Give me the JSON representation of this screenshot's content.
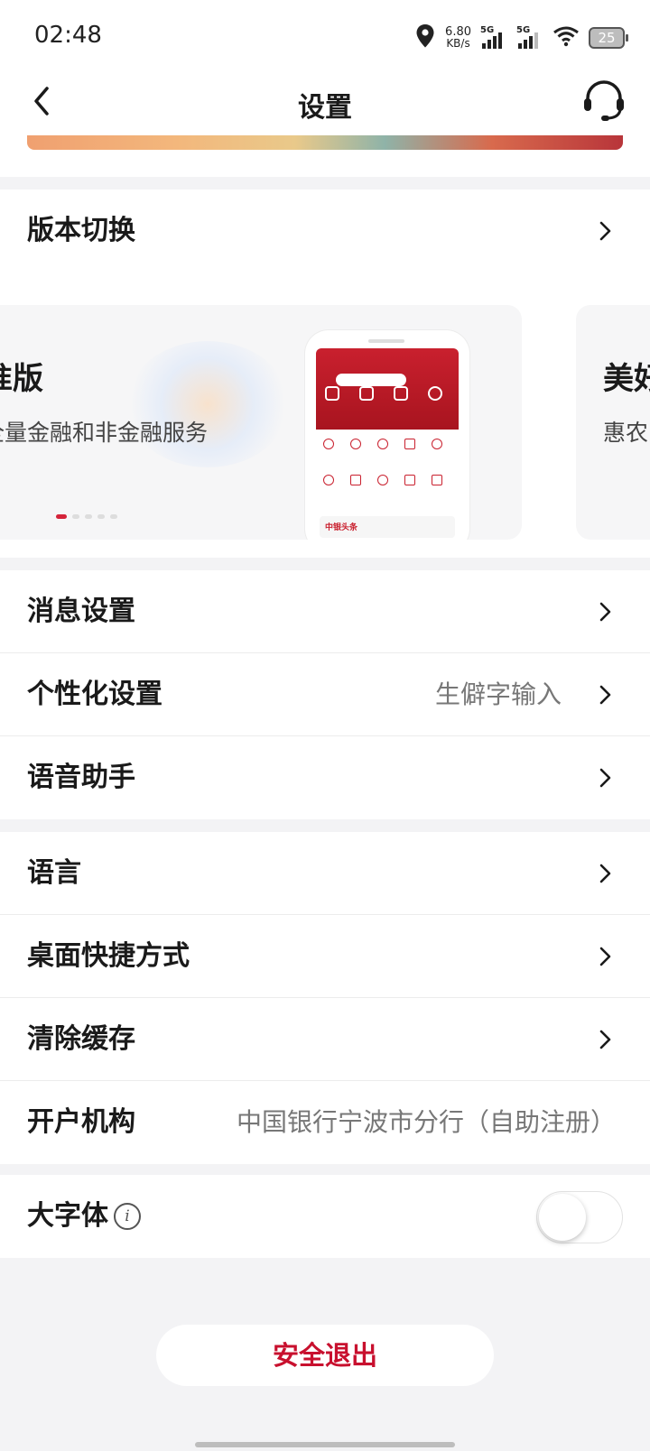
{
  "status_bar": {
    "time": "02:48",
    "net_speed_value": "6.80",
    "net_speed_unit": "KB/s",
    "sim1_label": "5G",
    "sim2_label": "5G",
    "battery": "25"
  },
  "header": {
    "title": "设置"
  },
  "version_section": {
    "label": "版本切换"
  },
  "version_carousel": {
    "cards": [
      {
        "title": "准版",
        "subtitle": "全量金融和非金融服务"
      },
      {
        "title": "美好",
        "subtitle": "惠农"
      }
    ],
    "dots": 5,
    "active_dot": 0,
    "preview": {
      "news_label": "中银头条"
    }
  },
  "settings_group_1": [
    {
      "label": "消息设置",
      "value": ""
    },
    {
      "label": "个性化设置",
      "value": "生僻字输入"
    },
    {
      "label": "语音助手",
      "value": ""
    }
  ],
  "settings_group_2": [
    {
      "label": "语言",
      "value": ""
    },
    {
      "label": "桌面快捷方式",
      "value": ""
    },
    {
      "label": "清除缓存",
      "value": ""
    },
    {
      "label": "开户机构",
      "value": "中国银行宁波市分行（自助注册）"
    }
  ],
  "large_font": {
    "label": "大字体",
    "info_glyph": "i",
    "enabled": false
  },
  "logout": {
    "label": "安全退出"
  },
  "colors": {
    "accent": "#c8102e",
    "background": "#f3f3f5"
  }
}
